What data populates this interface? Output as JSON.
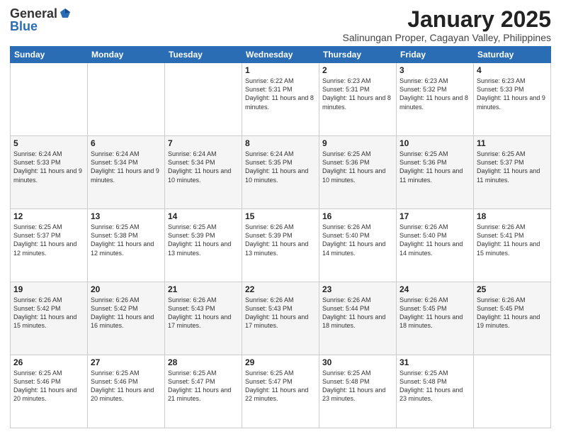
{
  "logo": {
    "general": "General",
    "blue": "Blue"
  },
  "header": {
    "month": "January 2025",
    "location": "Salinungan Proper, Cagayan Valley, Philippines"
  },
  "weekdays": [
    "Sunday",
    "Monday",
    "Tuesday",
    "Wednesday",
    "Thursday",
    "Friday",
    "Saturday"
  ],
  "weeks": [
    [
      {
        "day": "",
        "sunrise": "",
        "sunset": "",
        "daylight": ""
      },
      {
        "day": "",
        "sunrise": "",
        "sunset": "",
        "daylight": ""
      },
      {
        "day": "",
        "sunrise": "",
        "sunset": "",
        "daylight": ""
      },
      {
        "day": "1",
        "sunrise": "Sunrise: 6:22 AM",
        "sunset": "Sunset: 5:31 PM",
        "daylight": "Daylight: 11 hours and 8 minutes."
      },
      {
        "day": "2",
        "sunrise": "Sunrise: 6:23 AM",
        "sunset": "Sunset: 5:31 PM",
        "daylight": "Daylight: 11 hours and 8 minutes."
      },
      {
        "day": "3",
        "sunrise": "Sunrise: 6:23 AM",
        "sunset": "Sunset: 5:32 PM",
        "daylight": "Daylight: 11 hours and 8 minutes."
      },
      {
        "day": "4",
        "sunrise": "Sunrise: 6:23 AM",
        "sunset": "Sunset: 5:33 PM",
        "daylight": "Daylight: 11 hours and 9 minutes."
      }
    ],
    [
      {
        "day": "5",
        "sunrise": "Sunrise: 6:24 AM",
        "sunset": "Sunset: 5:33 PM",
        "daylight": "Daylight: 11 hours and 9 minutes."
      },
      {
        "day": "6",
        "sunrise": "Sunrise: 6:24 AM",
        "sunset": "Sunset: 5:34 PM",
        "daylight": "Daylight: 11 hours and 9 minutes."
      },
      {
        "day": "7",
        "sunrise": "Sunrise: 6:24 AM",
        "sunset": "Sunset: 5:34 PM",
        "daylight": "Daylight: 11 hours and 10 minutes."
      },
      {
        "day": "8",
        "sunrise": "Sunrise: 6:24 AM",
        "sunset": "Sunset: 5:35 PM",
        "daylight": "Daylight: 11 hours and 10 minutes."
      },
      {
        "day": "9",
        "sunrise": "Sunrise: 6:25 AM",
        "sunset": "Sunset: 5:36 PM",
        "daylight": "Daylight: 11 hours and 10 minutes."
      },
      {
        "day": "10",
        "sunrise": "Sunrise: 6:25 AM",
        "sunset": "Sunset: 5:36 PM",
        "daylight": "Daylight: 11 hours and 11 minutes."
      },
      {
        "day": "11",
        "sunrise": "Sunrise: 6:25 AM",
        "sunset": "Sunset: 5:37 PM",
        "daylight": "Daylight: 11 hours and 11 minutes."
      }
    ],
    [
      {
        "day": "12",
        "sunrise": "Sunrise: 6:25 AM",
        "sunset": "Sunset: 5:37 PM",
        "daylight": "Daylight: 11 hours and 12 minutes."
      },
      {
        "day": "13",
        "sunrise": "Sunrise: 6:25 AM",
        "sunset": "Sunset: 5:38 PM",
        "daylight": "Daylight: 11 hours and 12 minutes."
      },
      {
        "day": "14",
        "sunrise": "Sunrise: 6:25 AM",
        "sunset": "Sunset: 5:39 PM",
        "daylight": "Daylight: 11 hours and 13 minutes."
      },
      {
        "day": "15",
        "sunrise": "Sunrise: 6:26 AM",
        "sunset": "Sunset: 5:39 PM",
        "daylight": "Daylight: 11 hours and 13 minutes."
      },
      {
        "day": "16",
        "sunrise": "Sunrise: 6:26 AM",
        "sunset": "Sunset: 5:40 PM",
        "daylight": "Daylight: 11 hours and 14 minutes."
      },
      {
        "day": "17",
        "sunrise": "Sunrise: 6:26 AM",
        "sunset": "Sunset: 5:40 PM",
        "daylight": "Daylight: 11 hours and 14 minutes."
      },
      {
        "day": "18",
        "sunrise": "Sunrise: 6:26 AM",
        "sunset": "Sunset: 5:41 PM",
        "daylight": "Daylight: 11 hours and 15 minutes."
      }
    ],
    [
      {
        "day": "19",
        "sunrise": "Sunrise: 6:26 AM",
        "sunset": "Sunset: 5:42 PM",
        "daylight": "Daylight: 11 hours and 15 minutes."
      },
      {
        "day": "20",
        "sunrise": "Sunrise: 6:26 AM",
        "sunset": "Sunset: 5:42 PM",
        "daylight": "Daylight: 11 hours and 16 minutes."
      },
      {
        "day": "21",
        "sunrise": "Sunrise: 6:26 AM",
        "sunset": "Sunset: 5:43 PM",
        "daylight": "Daylight: 11 hours and 17 minutes."
      },
      {
        "day": "22",
        "sunrise": "Sunrise: 6:26 AM",
        "sunset": "Sunset: 5:43 PM",
        "daylight": "Daylight: 11 hours and 17 minutes."
      },
      {
        "day": "23",
        "sunrise": "Sunrise: 6:26 AM",
        "sunset": "Sunset: 5:44 PM",
        "daylight": "Daylight: 11 hours and 18 minutes."
      },
      {
        "day": "24",
        "sunrise": "Sunrise: 6:26 AM",
        "sunset": "Sunset: 5:45 PM",
        "daylight": "Daylight: 11 hours and 18 minutes."
      },
      {
        "day": "25",
        "sunrise": "Sunrise: 6:26 AM",
        "sunset": "Sunset: 5:45 PM",
        "daylight": "Daylight: 11 hours and 19 minutes."
      }
    ],
    [
      {
        "day": "26",
        "sunrise": "Sunrise: 6:25 AM",
        "sunset": "Sunset: 5:46 PM",
        "daylight": "Daylight: 11 hours and 20 minutes."
      },
      {
        "day": "27",
        "sunrise": "Sunrise: 6:25 AM",
        "sunset": "Sunset: 5:46 PM",
        "daylight": "Daylight: 11 hours and 20 minutes."
      },
      {
        "day": "28",
        "sunrise": "Sunrise: 6:25 AM",
        "sunset": "Sunset: 5:47 PM",
        "daylight": "Daylight: 11 hours and 21 minutes."
      },
      {
        "day": "29",
        "sunrise": "Sunrise: 6:25 AM",
        "sunset": "Sunset: 5:47 PM",
        "daylight": "Daylight: 11 hours and 22 minutes."
      },
      {
        "day": "30",
        "sunrise": "Sunrise: 6:25 AM",
        "sunset": "Sunset: 5:48 PM",
        "daylight": "Daylight: 11 hours and 23 minutes."
      },
      {
        "day": "31",
        "sunrise": "Sunrise: 6:25 AM",
        "sunset": "Sunset: 5:48 PM",
        "daylight": "Daylight: 11 hours and 23 minutes."
      },
      {
        "day": "",
        "sunrise": "",
        "sunset": "",
        "daylight": ""
      }
    ]
  ]
}
